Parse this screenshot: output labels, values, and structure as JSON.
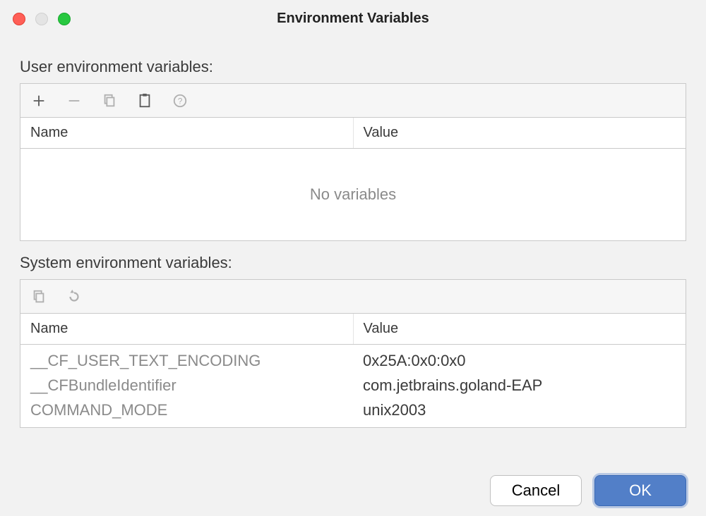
{
  "title": "Environment Variables",
  "user_section": {
    "label": "User environment variables:",
    "columns": {
      "name": "Name",
      "value": "Value"
    },
    "empty_message": "No variables",
    "rows": []
  },
  "system_section": {
    "label": "System environment variables:",
    "columns": {
      "name": "Name",
      "value": "Value"
    },
    "rows": [
      {
        "name": "__CF_USER_TEXT_ENCODING",
        "value": "0x25A:0x0:0x0"
      },
      {
        "name": "__CFBundleIdentifier",
        "value": "com.jetbrains.goland-EAP"
      },
      {
        "name": "COMMAND_MODE",
        "value": "unix2003"
      }
    ]
  },
  "buttons": {
    "cancel": "Cancel",
    "ok": "OK"
  }
}
